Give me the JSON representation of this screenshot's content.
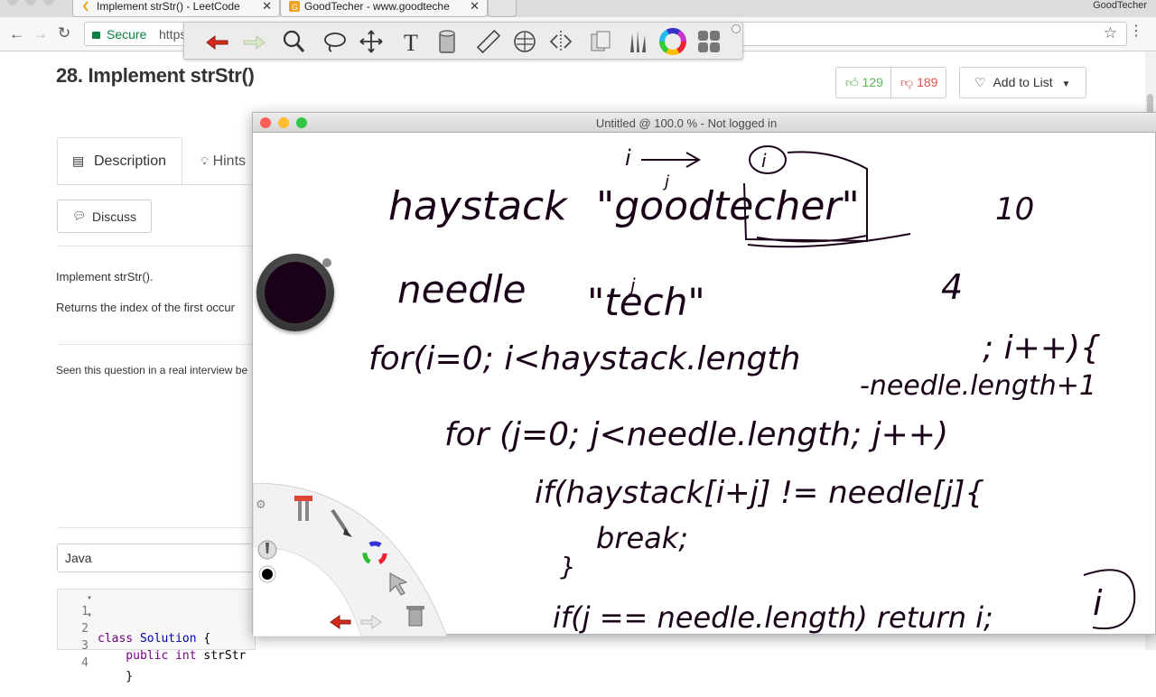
{
  "browser": {
    "tabs": [
      {
        "title": "Implement strStr() - LeetCode"
      },
      {
        "title": "GoodTecher - www.goodteche"
      }
    ],
    "profile_name": "GoodTecher",
    "secure_label": "Secure",
    "url_visible": "https:"
  },
  "leetcode": {
    "problem_title": "28. Implement strStr()",
    "upvotes": "129",
    "downvotes": "189",
    "add_to_list_label": "Add to List",
    "tabs": {
      "description": "Description",
      "hints": "Hints"
    },
    "discuss_label": "Discuss",
    "body_line1": "Implement strStr().",
    "body_line2": "Returns the index of the first occur",
    "interview_note": "Seen this question in a real interview be",
    "language": "Java",
    "code_lines": [
      {
        "num": "1",
        "fold": "▾",
        "kw": "class",
        "ty": "Solution",
        "rest": " {"
      },
      {
        "num": "2",
        "fold": "▾",
        "kw": "    public int",
        "ty": "",
        "rest": " strStr"
      },
      {
        "num": "3",
        "fold": "",
        "kw": "",
        "ty": "",
        "rest": ""
      },
      {
        "num": "4",
        "fold": "",
        "kw": "",
        "ty": "",
        "rest": "    }"
      }
    ]
  },
  "whiteboard": {
    "window_title": "Untitled @ 100.0 % - Not logged in",
    "ink_color": "#1a0318",
    "traffic_lights": [
      "#fc5f57",
      "#fdbc2e",
      "#33c748"
    ],
    "handwriting": [
      "haystack",
      "\"goodtecher\"",
      "10",
      "needle",
      "\"tech\"",
      "4",
      "for(i=0; i<haystack.length",
      "; i++){",
      "-needle.length+1",
      "for (j=0; j<needle.length; j++)",
      "if(haystack[i+j] != needle[j]{",
      "break;",
      "}",
      "if(j == needle.length) return i;",
      "i",
      "j",
      "i",
      "j",
      "i"
    ]
  },
  "drawing_toolbar": {
    "tools": [
      "undo-icon",
      "redo-icon",
      "magnifier-icon",
      "lasso-icon",
      "move-icon",
      "text-icon",
      "eraser-icon",
      "ruler-icon",
      "grid-icon",
      "mirror-icon",
      "copy-icon",
      "brushes-icon",
      "color-wheel-icon",
      "more-icon"
    ]
  }
}
